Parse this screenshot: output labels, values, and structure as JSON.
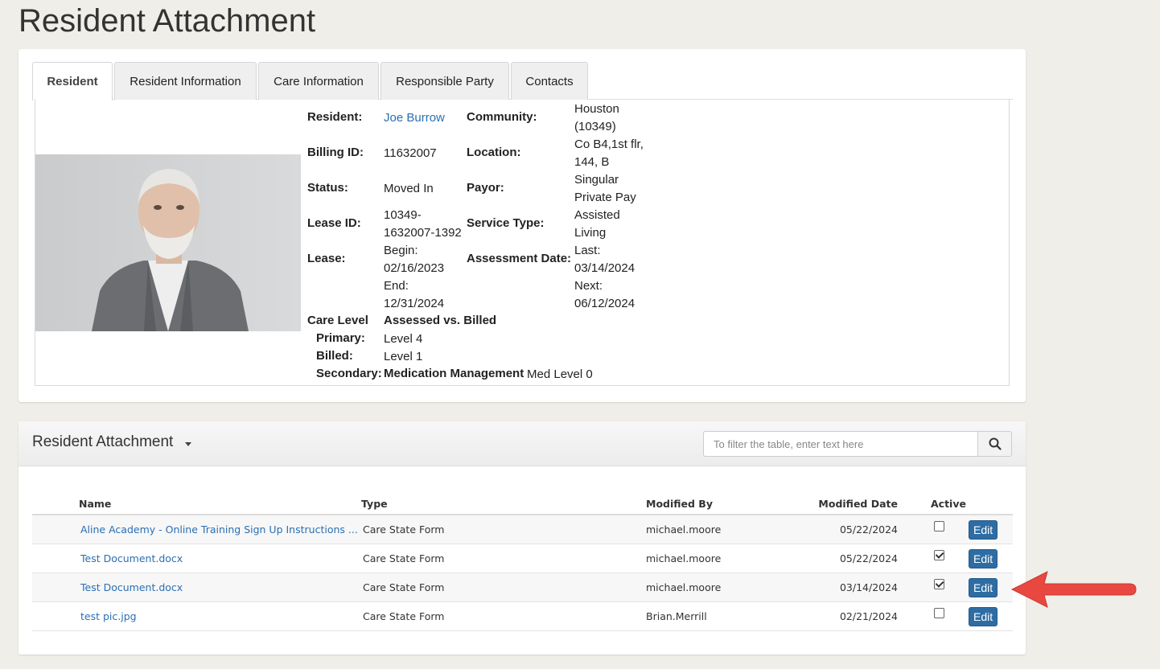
{
  "page_title": "Resident Attachment",
  "tabs": [
    {
      "label": "Resident",
      "active": true
    },
    {
      "label": "Resident Information",
      "active": false
    },
    {
      "label": "Care Information",
      "active": false
    },
    {
      "label": "Responsible Party",
      "active": false
    },
    {
      "label": "Contacts",
      "active": false
    }
  ],
  "resident": {
    "resident_label": "Resident:",
    "resident_name": "Joe Burrow",
    "billing_id_label": "Billing ID:",
    "billing_id": "11632007",
    "status_label": "Status:",
    "status": "Moved In",
    "lease_id_label": "Lease ID:",
    "lease_id_1": "10349-",
    "lease_id_2": "1632007-1392",
    "lease_label": "Lease:",
    "lease_begin_label": "Begin:",
    "lease_begin": "02/16/2023",
    "lease_end_label": "End:",
    "lease_end": "12/31/2024",
    "community_label": "Community:",
    "community_1": "Houston",
    "community_2": "(10349)",
    "location_label": "Location:",
    "location_1": "Co B4,1st flr,",
    "location_2": "144, B",
    "payor_label": "Payor:",
    "payor_1": "Singular",
    "payor_2": "Private Pay",
    "service_type_label": "Service Type:",
    "service_type_1": "Assisted",
    "service_type_2": "Living",
    "assessment_label": "Assessment Date:",
    "assessment_last_label": "Last:",
    "assessment_last": "03/14/2024",
    "assessment_next_label": "Next:",
    "assessment_next": "06/12/2024",
    "care_level_label": "Care Level",
    "assessed_vs_billed": "Assessed vs. Billed",
    "primary_label": "Primary:",
    "primary": "Level 4",
    "billed_label": "Billed:",
    "billed": "Level 1",
    "secondary_label": "Secondary:",
    "secondary_name": "Medication Management",
    "secondary_value": "Med Level 0"
  },
  "attachments": {
    "title": "Resident Attachment",
    "search_placeholder": "To filter the table, enter text here",
    "columns": {
      "name": "Name",
      "type": "Type",
      "modified_by": "Modified By",
      "modified_date": "Modified Date",
      "active": "Active"
    },
    "edit_label": "Edit",
    "rows": [
      {
        "name": "Aline Academy - Online Training Sign Up Instructions ...",
        "type": "Care State Form",
        "modified_by": "michael.moore",
        "modified_date": "05/22/2024",
        "active": false
      },
      {
        "name": "Test Document.docx",
        "type": "Care State Form",
        "modified_by": "michael.moore",
        "modified_date": "05/22/2024",
        "active": true
      },
      {
        "name": "Test Document.docx",
        "type": "Care State Form",
        "modified_by": "michael.moore",
        "modified_date": "03/14/2024",
        "active": true
      },
      {
        "name": "test pic.jpg",
        "type": "Care State Form",
        "modified_by": "Brian.Merrill",
        "modified_date": "02/21/2024",
        "active": false
      }
    ]
  },
  "colors": {
    "link": "#2a6fb3",
    "edit_button": "#2e6da4",
    "annotation_arrow": "#e8483f",
    "page_background": "#f0eee8"
  },
  "icons": {
    "search": "search-icon",
    "caret": "caret-down-icon",
    "arrow": "annotation-arrow-icon"
  }
}
